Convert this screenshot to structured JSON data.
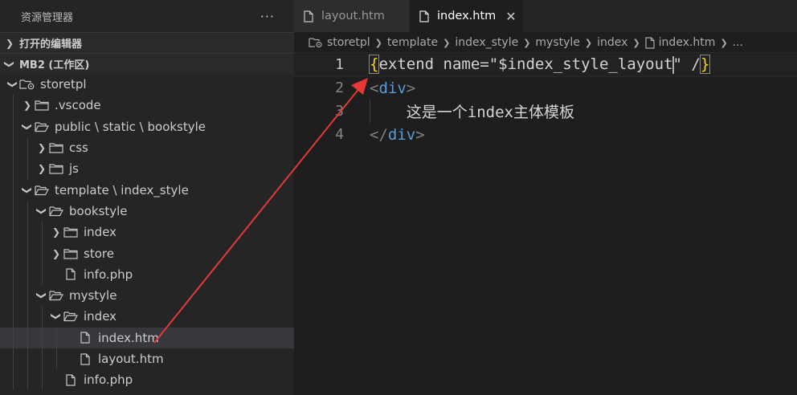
{
  "sidebar": {
    "title": "资源管理器",
    "more": "···",
    "open_editors": "打开的编辑器",
    "workspace": "MB2 (工作区)",
    "tree": [
      {
        "label": "storetpl",
        "depth": 0,
        "type": "root",
        "expanded": true
      },
      {
        "label": ".vscode",
        "depth": 1,
        "type": "folder",
        "expanded": false
      },
      {
        "label": "public \\ static \\ bookstyle",
        "depth": 1,
        "type": "folder",
        "expanded": true
      },
      {
        "label": "css",
        "depth": 2,
        "type": "folder",
        "expanded": false
      },
      {
        "label": "js",
        "depth": 2,
        "type": "folder",
        "expanded": false
      },
      {
        "label": "template \\ index_style",
        "depth": 1,
        "type": "folder",
        "expanded": true
      },
      {
        "label": "bookstyle",
        "depth": 2,
        "type": "folder",
        "expanded": true
      },
      {
        "label": "index",
        "depth": 3,
        "type": "folder",
        "expanded": false
      },
      {
        "label": "store",
        "depth": 3,
        "type": "folder",
        "expanded": false
      },
      {
        "label": "info.php",
        "depth": 3,
        "type": "file"
      },
      {
        "label": "mystyle",
        "depth": 2,
        "type": "folder",
        "expanded": true
      },
      {
        "label": "index",
        "depth": 3,
        "type": "folder",
        "expanded": true
      },
      {
        "label": "index.htm",
        "depth": 4,
        "type": "file",
        "selected": true
      },
      {
        "label": "layout.htm",
        "depth": 4,
        "type": "file"
      },
      {
        "label": "info.php",
        "depth": 3,
        "type": "file"
      }
    ]
  },
  "tabs": [
    {
      "label": "layout.htm",
      "active": false
    },
    {
      "label": "index.htm",
      "active": true,
      "close": "✕"
    }
  ],
  "breadcrumb": [
    "storetpl",
    "template",
    "index_style",
    "mystyle",
    "index",
    "index.htm",
    "..."
  ],
  "editor": {
    "line_numbers": [
      "1",
      "2",
      "3",
      "4"
    ],
    "line1": {
      "open": "{",
      "text_before_cursor": "extend name=\"$index_style_layout",
      "text_after_cursor": "\" /",
      "close": "}"
    },
    "line2": {
      "lt": "<",
      "tag": "div",
      "gt": ">"
    },
    "line3": {
      "text": "    这是一个index主体模板"
    },
    "line4": {
      "lt": "</",
      "tag": "div",
      "gt": ">"
    }
  },
  "colors": {
    "arrow": "#e53935",
    "sidebar_bg": "#252526",
    "editor_bg": "#1e1e1e",
    "tag": "#569cd6",
    "brace": "#ffd700"
  }
}
